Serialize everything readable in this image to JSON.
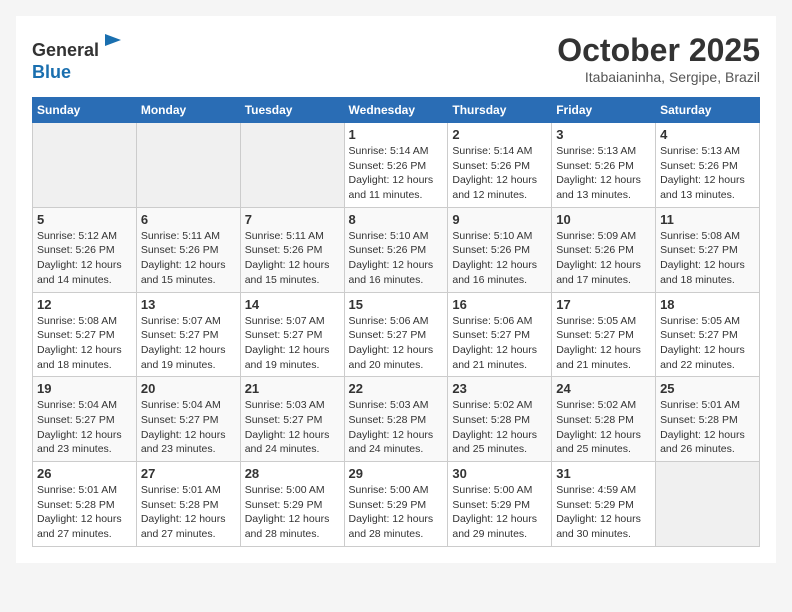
{
  "logo": {
    "general": "General",
    "blue": "Blue"
  },
  "header": {
    "month": "October 2025",
    "location": "Itabaianinha, Sergipe, Brazil"
  },
  "days_of_week": [
    "Sunday",
    "Monday",
    "Tuesday",
    "Wednesday",
    "Thursday",
    "Friday",
    "Saturday"
  ],
  "weeks": [
    [
      {
        "day": "",
        "info": ""
      },
      {
        "day": "",
        "info": ""
      },
      {
        "day": "",
        "info": ""
      },
      {
        "day": "1",
        "info": "Sunrise: 5:14 AM\nSunset: 5:26 PM\nDaylight: 12 hours and 11 minutes."
      },
      {
        "day": "2",
        "info": "Sunrise: 5:14 AM\nSunset: 5:26 PM\nDaylight: 12 hours and 12 minutes."
      },
      {
        "day": "3",
        "info": "Sunrise: 5:13 AM\nSunset: 5:26 PM\nDaylight: 12 hours and 13 minutes."
      },
      {
        "day": "4",
        "info": "Sunrise: 5:13 AM\nSunset: 5:26 PM\nDaylight: 12 hours and 13 minutes."
      }
    ],
    [
      {
        "day": "5",
        "info": "Sunrise: 5:12 AM\nSunset: 5:26 PM\nDaylight: 12 hours and 14 minutes."
      },
      {
        "day": "6",
        "info": "Sunrise: 5:11 AM\nSunset: 5:26 PM\nDaylight: 12 hours and 15 minutes."
      },
      {
        "day": "7",
        "info": "Sunrise: 5:11 AM\nSunset: 5:26 PM\nDaylight: 12 hours and 15 minutes."
      },
      {
        "day": "8",
        "info": "Sunrise: 5:10 AM\nSunset: 5:26 PM\nDaylight: 12 hours and 16 minutes."
      },
      {
        "day": "9",
        "info": "Sunrise: 5:10 AM\nSunset: 5:26 PM\nDaylight: 12 hours and 16 minutes."
      },
      {
        "day": "10",
        "info": "Sunrise: 5:09 AM\nSunset: 5:26 PM\nDaylight: 12 hours and 17 minutes."
      },
      {
        "day": "11",
        "info": "Sunrise: 5:08 AM\nSunset: 5:27 PM\nDaylight: 12 hours and 18 minutes."
      }
    ],
    [
      {
        "day": "12",
        "info": "Sunrise: 5:08 AM\nSunset: 5:27 PM\nDaylight: 12 hours and 18 minutes."
      },
      {
        "day": "13",
        "info": "Sunrise: 5:07 AM\nSunset: 5:27 PM\nDaylight: 12 hours and 19 minutes."
      },
      {
        "day": "14",
        "info": "Sunrise: 5:07 AM\nSunset: 5:27 PM\nDaylight: 12 hours and 19 minutes."
      },
      {
        "day": "15",
        "info": "Sunrise: 5:06 AM\nSunset: 5:27 PM\nDaylight: 12 hours and 20 minutes."
      },
      {
        "day": "16",
        "info": "Sunrise: 5:06 AM\nSunset: 5:27 PM\nDaylight: 12 hours and 21 minutes."
      },
      {
        "day": "17",
        "info": "Sunrise: 5:05 AM\nSunset: 5:27 PM\nDaylight: 12 hours and 21 minutes."
      },
      {
        "day": "18",
        "info": "Sunrise: 5:05 AM\nSunset: 5:27 PM\nDaylight: 12 hours and 22 minutes."
      }
    ],
    [
      {
        "day": "19",
        "info": "Sunrise: 5:04 AM\nSunset: 5:27 PM\nDaylight: 12 hours and 23 minutes."
      },
      {
        "day": "20",
        "info": "Sunrise: 5:04 AM\nSunset: 5:27 PM\nDaylight: 12 hours and 23 minutes."
      },
      {
        "day": "21",
        "info": "Sunrise: 5:03 AM\nSunset: 5:27 PM\nDaylight: 12 hours and 24 minutes."
      },
      {
        "day": "22",
        "info": "Sunrise: 5:03 AM\nSunset: 5:28 PM\nDaylight: 12 hours and 24 minutes."
      },
      {
        "day": "23",
        "info": "Sunrise: 5:02 AM\nSunset: 5:28 PM\nDaylight: 12 hours and 25 minutes."
      },
      {
        "day": "24",
        "info": "Sunrise: 5:02 AM\nSunset: 5:28 PM\nDaylight: 12 hours and 25 minutes."
      },
      {
        "day": "25",
        "info": "Sunrise: 5:01 AM\nSunset: 5:28 PM\nDaylight: 12 hours and 26 minutes."
      }
    ],
    [
      {
        "day": "26",
        "info": "Sunrise: 5:01 AM\nSunset: 5:28 PM\nDaylight: 12 hours and 27 minutes."
      },
      {
        "day": "27",
        "info": "Sunrise: 5:01 AM\nSunset: 5:28 PM\nDaylight: 12 hours and 27 minutes."
      },
      {
        "day": "28",
        "info": "Sunrise: 5:00 AM\nSunset: 5:29 PM\nDaylight: 12 hours and 28 minutes."
      },
      {
        "day": "29",
        "info": "Sunrise: 5:00 AM\nSunset: 5:29 PM\nDaylight: 12 hours and 28 minutes."
      },
      {
        "day": "30",
        "info": "Sunrise: 5:00 AM\nSunset: 5:29 PM\nDaylight: 12 hours and 29 minutes."
      },
      {
        "day": "31",
        "info": "Sunrise: 4:59 AM\nSunset: 5:29 PM\nDaylight: 12 hours and 30 minutes."
      },
      {
        "day": "",
        "info": ""
      }
    ]
  ]
}
